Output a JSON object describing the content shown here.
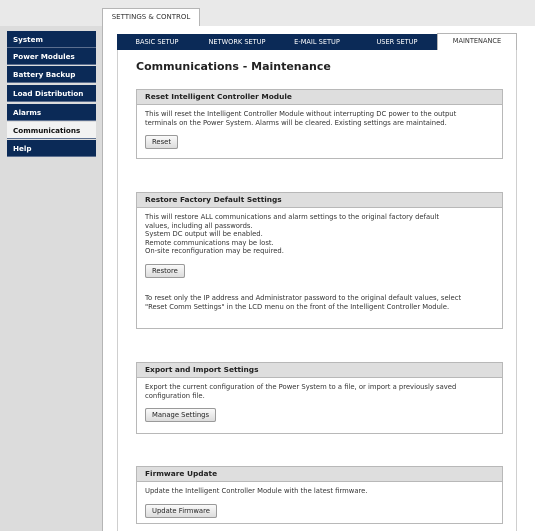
{
  "top_tab": "SETTINGS & CONTROL",
  "sidebar": {
    "items": [
      {
        "label": "System"
      },
      {
        "label": "Power Modules"
      },
      {
        "label": "Battery Backup"
      },
      {
        "label": "Load Distribution"
      },
      {
        "label": "Alarms"
      },
      {
        "label": "Communications",
        "active": true
      },
      {
        "label": "Help"
      }
    ]
  },
  "tabs": [
    {
      "label": "BASIC SETUP"
    },
    {
      "label": "NETWORK SETUP"
    },
    {
      "label": "E-MAIL SETUP"
    },
    {
      "label": "USER SETUP"
    },
    {
      "label": "MAINTENANCE",
      "active": true
    }
  ],
  "page_title": "Communications - Maintenance",
  "sections": {
    "reset": {
      "title": "Reset Intelligent Controller Module",
      "lines": [
        "This will reset the Intelligent Controller Module without interrupting DC power to the output",
        "terminals on the Power System. Alarms will be cleared. Existing settings are maintained."
      ],
      "button": "Reset"
    },
    "restore": {
      "title": "Restore Factory Default Settings",
      "lines": [
        "This will restore ALL communications and alarm settings to the original factory default",
        "values, including all passwords.",
        "System DC output will be enabled.",
        "Remote communications may be lost.",
        "On-site reconfiguration may be required."
      ],
      "button": "Restore",
      "note_lines": [
        "To reset only the IP address and Administrator password to the original default values, select",
        "\"Reset Comm Settings\" in the LCD menu on the front of the Intelligent Controller Module."
      ]
    },
    "export": {
      "title": "Export and Import Settings",
      "lines": [
        "Export the current configuration of the Power System to a file, or import a previously saved",
        "configuration file."
      ],
      "button": "Manage Settings"
    },
    "firmware": {
      "title": "Firmware Update",
      "lines": [
        "Update the Intelligent Controller Module with the latest firmware."
      ],
      "button": "Update Firmware"
    }
  }
}
